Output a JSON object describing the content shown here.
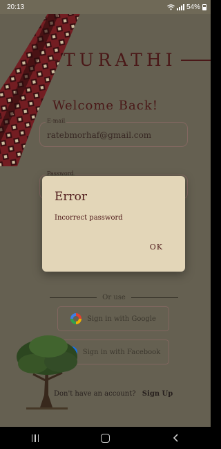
{
  "status_bar": {
    "time": "20:13",
    "battery": "54%"
  },
  "app": {
    "brand": "TURATHI",
    "welcome": "Welcome Back!"
  },
  "form": {
    "email": {
      "label": "E-mail",
      "value": "ratebmorhaf@gmail.com"
    },
    "password": {
      "label": "Password",
      "value": ""
    }
  },
  "divider_text": "Or use",
  "social": {
    "google_label": "Sign in with Google",
    "facebook_label": "Sign in with Facebook"
  },
  "signup": {
    "prompt": "Don't have an account?",
    "link": "Sign Up"
  },
  "dialog": {
    "title": "Error",
    "message": "Incorrect password",
    "ok": "OK"
  },
  "icons": [
    "wifi-icon",
    "signal-icon",
    "battery-icon",
    "google-icon",
    "facebook-icon",
    "recents-icon",
    "home-icon",
    "back-icon"
  ]
}
